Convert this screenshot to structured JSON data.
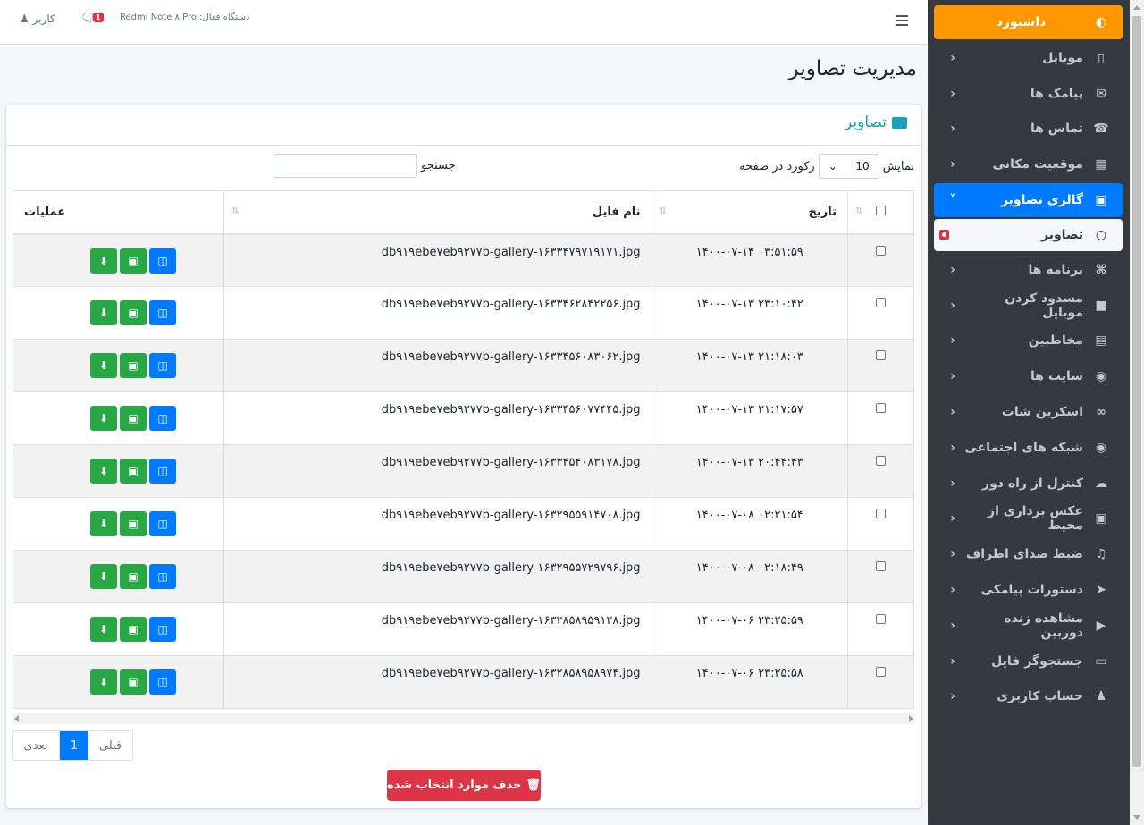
{
  "header": {
    "user_label": "کاربر",
    "msg_count": "1",
    "device_label": "دستگاه فعال: Redmi Note ۸ Pro"
  },
  "page_title": "مدیریت تصاویر",
  "card": {
    "title": "تصاویر",
    "show_label": "نمایش",
    "page_size": "10",
    "per_page_label": "رکورد در صفحه",
    "search_label": "جستجو",
    "search_value": ""
  },
  "table": {
    "headers": {
      "date": "تاریخ",
      "file": "نام فایل",
      "ops": "عملیات"
    },
    "rows": [
      {
        "date": "۱۴۰۰-۰۷-۱۴ ۰۳:۵۱:۵۹",
        "file": "db۹۱۹ebe۷eb۹۲۷۷b-gallery-۱۶۳۳۴۷۹۷۱۹۱۷۱.jpg"
      },
      {
        "date": "۱۴۰۰-۰۷-۱۳ ۲۳:۱۰:۴۲",
        "file": "db۹۱۹ebe۷eb۹۲۷۷b-gallery-۱۶۳۳۴۶۲۸۴۲۲۵۶.jpg"
      },
      {
        "date": "۱۴۰۰-۰۷-۱۳ ۲۱:۱۸:۰۳",
        "file": "db۹۱۹ebe۷eb۹۲۷۷b-gallery-۱۶۳۳۴۵۶۰۸۳۰۶۲.jpg"
      },
      {
        "date": "۱۴۰۰-۰۷-۱۳ ۲۱:۱۷:۵۷",
        "file": "db۹۱۹ebe۷eb۹۲۷۷b-gallery-۱۶۳۳۴۵۶۰۷۷۴۴۵.jpg"
      },
      {
        "date": "۱۴۰۰-۰۷-۱۳ ۲۰:۴۴:۴۳",
        "file": "db۹۱۹ebe۷eb۹۲۷۷b-gallery-۱۶۳۳۴۵۴۰۸۳۱۷۸.jpg"
      },
      {
        "date": "۱۴۰۰-۰۷-۰۸ ۰۲:۲۱:۵۴",
        "file": "db۹۱۹ebe۷eb۹۲۷۷b-gallery-۱۶۳۲۹۵۵۹۱۴۷۰۸.jpg"
      },
      {
        "date": "۱۴۰۰-۰۷-۰۸ ۰۲:۱۸:۴۹",
        "file": "db۹۱۹ebe۷eb۹۲۷۷b-gallery-۱۶۳۲۹۵۵۷۲۹۷۹۶.jpg"
      },
      {
        "date": "۱۴۰۰-۰۷-۰۶ ۲۳:۲۵:۵۹",
        "file": "db۹۱۹ebe۷eb۹۲۷۷b-gallery-۱۶۳۲۸۵۸۹۵۹۱۲۸.jpg"
      },
      {
        "date": "۱۴۰۰-۰۷-۰۶ ۲۳:۲۵:۵۸",
        "file": "db۹۱۹ebe۷eb۹۲۷۷b-gallery-۱۶۳۲۸۵۸۹۵۸۹۷۴.jpg"
      }
    ]
  },
  "pagination": {
    "prev": "قبلی",
    "current": "1",
    "next": "بعدی"
  },
  "delete_label": "حذف موارد انتخاب شده",
  "sidebar": {
    "items": [
      {
        "label": "داشبورد",
        "icon": "dashboard-icon"
      },
      {
        "label": "موبایل",
        "icon": "mobile-icon"
      },
      {
        "label": "پیامک ها",
        "icon": "envelope-icon"
      },
      {
        "label": "تماس ها",
        "icon": "phone-icon"
      },
      {
        "label": "موقعیت مکانی",
        "icon": "map-icon"
      },
      {
        "label": "گالری تصاویر",
        "icon": "image-icon"
      },
      {
        "label": "تصاویر",
        "icon": "circle-icon"
      },
      {
        "label": "برنامه ها",
        "icon": "gamepad-icon"
      },
      {
        "label": "مسدود کردن موبایل",
        "icon": "lock-icon"
      },
      {
        "label": "مخاطبین",
        "icon": "book-icon"
      },
      {
        "label": "سایت ها",
        "icon": "chrome-icon"
      },
      {
        "label": "اسکرین شات",
        "icon": "binoculars-icon"
      },
      {
        "label": "شبکه های اجتماعی",
        "icon": "eye-icon"
      },
      {
        "label": "کنترل از راه دور",
        "icon": "cloud-icon"
      },
      {
        "label": "عکس برداری از محیط",
        "icon": "camera-icon"
      },
      {
        "label": "ضبط صدای اطراف",
        "icon": "audio-file-icon"
      },
      {
        "label": "دستورات پیامکی",
        "icon": "paper-plane-icon"
      },
      {
        "label": "مشاهده زنده دوربین",
        "icon": "video-icon"
      },
      {
        "label": "جستجوگر فایل",
        "icon": "folder-icon"
      },
      {
        "label": "حساب کاربری",
        "icon": "user-icon"
      }
    ]
  },
  "colors": {
    "accent": "#007bff",
    "dashboard": "#ff9800",
    "sidebar": "#343a40",
    "success": "#28a745",
    "danger": "#dc3545",
    "title": "#17a2b8"
  }
}
